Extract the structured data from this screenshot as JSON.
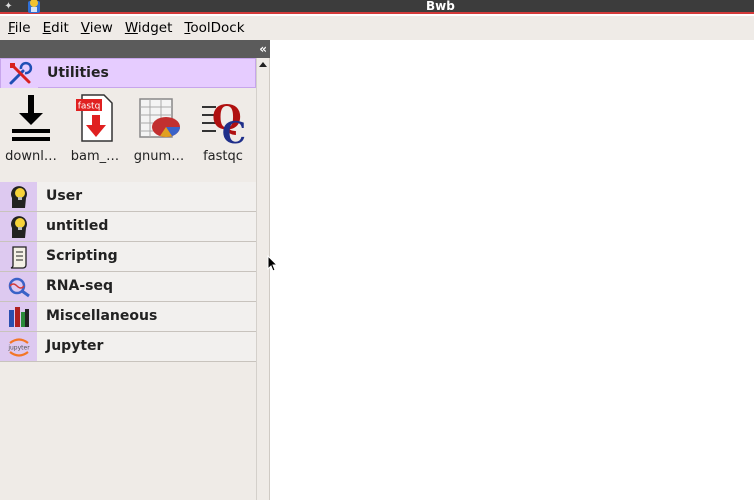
{
  "window": {
    "title": "Bwb"
  },
  "menubar": {
    "items": [
      {
        "label": "File",
        "underline": "F",
        "rest": "ile"
      },
      {
        "label": "Edit",
        "underline": "E",
        "rest": "dit"
      },
      {
        "label": "View",
        "underline": "V",
        "rest": "iew"
      },
      {
        "label": "Widget",
        "underline": "W",
        "rest": "idget"
      },
      {
        "label": "ToolDock",
        "underline": "T",
        "rest": "oolDock"
      }
    ]
  },
  "toolbox": {
    "collapse_glyph": "«",
    "active_category": {
      "label": "Utilities",
      "icon": "tools-icon",
      "widgets": [
        {
          "label": "downl…",
          "icon": "download-icon"
        },
        {
          "label": "bam_…",
          "icon": "fastq-file-icon"
        },
        {
          "label": "gnum…",
          "icon": "spreadsheet-chart-icon"
        },
        {
          "label": "fastqc",
          "icon": "fastqc-icon"
        }
      ]
    },
    "categories": [
      {
        "label": "User",
        "icon": "lightbulb-head-icon"
      },
      {
        "label": "untitled",
        "icon": "lightbulb-head-icon"
      },
      {
        "label": "Scripting",
        "icon": "script-scroll-icon"
      },
      {
        "label": "RNA-seq",
        "icon": "rna-magnifier-icon"
      },
      {
        "label": "Miscellaneous",
        "icon": "books-icon"
      },
      {
        "label": "Jupyter",
        "icon": "jupyter-icon"
      }
    ]
  },
  "colors": {
    "category_active_bg": "#e6ccff",
    "category_icon_bg": "#ddc9f0",
    "titlebar_bg": "#3c3c3c",
    "titlebar_accent": "#d33a3a",
    "dock_bg": "#efebe7"
  }
}
